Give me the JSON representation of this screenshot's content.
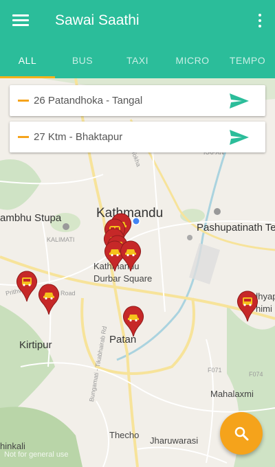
{
  "app": {
    "title": "Sawai Saathi",
    "menu_icon": "hamburger-menu-icon",
    "overflow_icon": "more-vert-icon"
  },
  "tabs": [
    {
      "label": "ALL",
      "active": true
    },
    {
      "label": "BUS",
      "active": false
    },
    {
      "label": "TAXI",
      "active": false
    },
    {
      "label": "MICRO",
      "active": false
    },
    {
      "label": "TEMPO",
      "active": false
    }
  ],
  "routes": [
    {
      "label": "26 Patandhoka - Tangal",
      "action_icon": "send-icon"
    },
    {
      "label": "27 Ktm - Bhaktapur",
      "action_icon": "send-icon"
    }
  ],
  "map": {
    "labels": {
      "kathmandu": "Kathmandu",
      "patan": "Patan",
      "kirtipur": "Kirtipur",
      "pashupatinath": "Pashupatinath Te",
      "swayambhu": "ambhu Stupa",
      "durbar_square_1": "Kathmandu",
      "durbar_square_2": "Durbar Square",
      "kalimati": "KALIMATI",
      "kapan": "KAPAN",
      "mahalaxmi": "Mahalaxmi",
      "thecho": "Thecho",
      "jharuwarasi": "Jharuwarasi",
      "khokana": "hinkali",
      "madhyapur_1": "Madhyap",
      "madhyapur_2": "himi",
      "road_prithvi": "Prithvi",
      "road_ring": "Road",
      "road_bungamati": "Bungamati - Tikabhairab Rd",
      "road_f071": "F071",
      "road_f074": "F074",
      "road_tokha": "Tokha"
    },
    "pins": [
      {
        "vehicle": "taxi-icon"
      },
      {
        "vehicle": "micro-icon"
      },
      {
        "vehicle": "taxi-icon"
      },
      {
        "vehicle": "bus-icon"
      },
      {
        "vehicle": "taxi-icon"
      },
      {
        "vehicle": "taxi-icon"
      },
      {
        "vehicle": "bus-icon"
      },
      {
        "vehicle": "taxi-icon"
      },
      {
        "vehicle": "taxi-icon"
      },
      {
        "vehicle": "bus-icon"
      }
    ],
    "pin_color": "#c62828",
    "my_location_color": "#4285f4"
  },
  "fab": {
    "icon": "search-icon"
  },
  "attribution": "Not for general use",
  "colors": {
    "primary": "#2bbd9a",
    "accent": "#f5a31b"
  }
}
